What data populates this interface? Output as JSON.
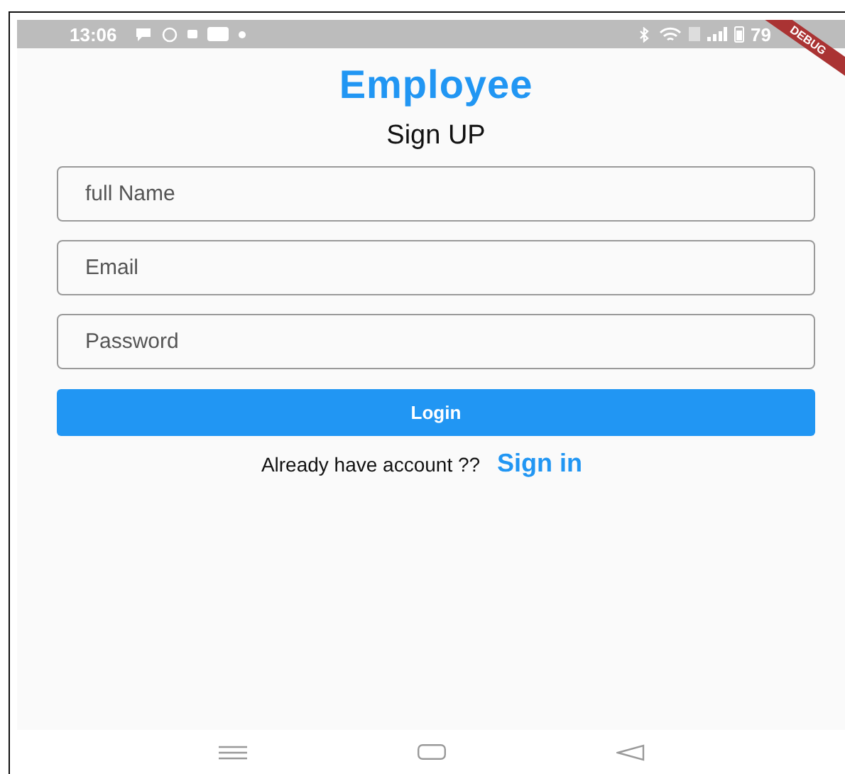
{
  "status_bar": {
    "time": "13:06",
    "battery": "79"
  },
  "debug_banner": "DEBUG",
  "title": "Employee",
  "subtitle": "Sign UP",
  "fields": [
    {
      "placeholder": "full Name"
    },
    {
      "placeholder": "Email"
    },
    {
      "placeholder": "Password"
    }
  ],
  "login_button": "Login",
  "signin_prompt": {
    "text": "Already have account ??",
    "link": "Sign in"
  }
}
